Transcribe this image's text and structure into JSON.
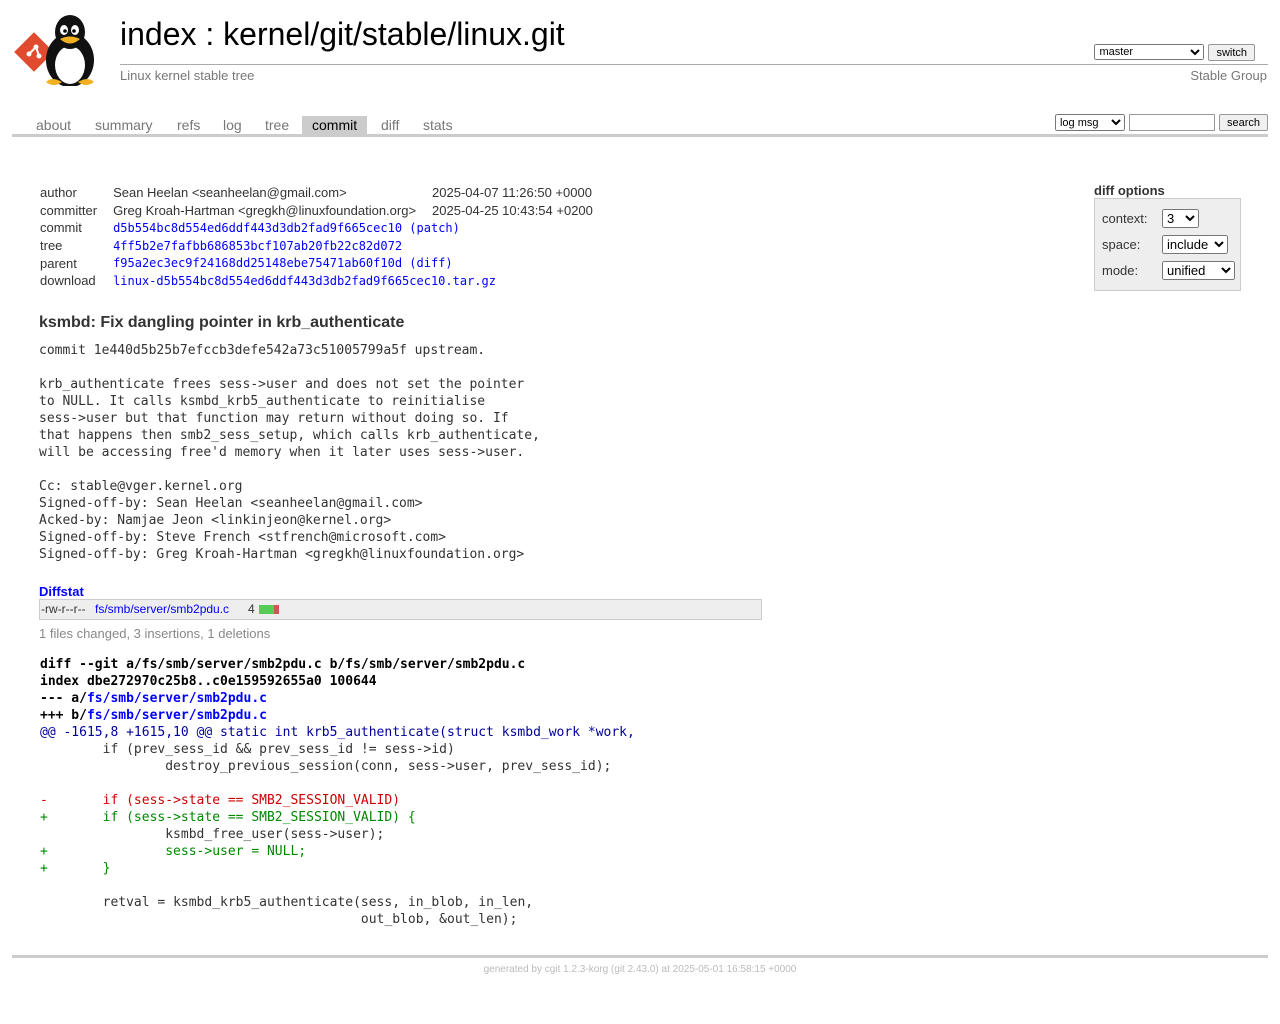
{
  "header": {
    "title_index": "index",
    "title_separator": " : ",
    "title_repo": "kernel/git/stable/linux.git",
    "description": "Linux kernel stable tree",
    "branch_selected": "master",
    "switch_label": "switch",
    "owner": "Stable Group"
  },
  "tabs": [
    "about",
    "summary",
    "refs",
    "log",
    "tree",
    "commit",
    "diff",
    "stats"
  ],
  "active_tab": "commit",
  "search": {
    "scope": "log msg",
    "button": "search"
  },
  "commit_info": {
    "author_label": "author",
    "author": "Sean Heelan <seanheelan@gmail.com>",
    "author_date": "2025-04-07 11:26:50 +0000",
    "committer_label": "committer",
    "committer": "Greg Kroah-Hartman <gregkh@linuxfoundation.org>",
    "committer_date": "2025-04-25 10:43:54 +0200",
    "commit_label": "commit",
    "commit": "d5b554bc8d554ed6ddf443d3db2fad9f665cec10",
    "patch_link": "patch",
    "tree_label": "tree",
    "tree": "4ff5b2e7fafbb686853bcf107ab20fb22c82d072",
    "parent_label": "parent",
    "parent": "f95a2ec3ec9f24168dd25148ebe75471ab60f10d",
    "diff_link": "diff",
    "download_label": "download",
    "download": "linux-d5b554bc8d554ed6ddf443d3db2fad9f665cec10.tar.gz"
  },
  "diff_options": {
    "title": "diff options",
    "context_label": "context:",
    "context_value": "3",
    "space_label": "space:",
    "space_value": "include",
    "mode_label": "mode:",
    "mode_value": "unified"
  },
  "subject": "ksmbd: Fix dangling pointer in krb_authenticate",
  "message": "commit 1e440d5b25b7efccb3defe542a73c51005799a5f upstream.\n\nkrb_authenticate frees sess->user and does not set the pointer\nto NULL. It calls ksmbd_krb5_authenticate to reinitialise\nsess->user but that function may return without doing so. If\nthat happens then smb2_sess_setup, which calls krb_authenticate,\nwill be accessing free'd memory when it later uses sess->user.\n\nCc: stable@vger.kernel.org\nSigned-off-by: Sean Heelan <seanheelan@gmail.com>\nAcked-by: Namjae Jeon <linkinjeon@kernel.org>\nSigned-off-by: Steve French <stfrench@microsoft.com>\nSigned-off-by: Greg Kroah-Hartman <gregkh@linuxfoundation.org>",
  "diffstat": {
    "header": "Diffstat",
    "mode": "-rw-r--r--",
    "path": "fs/smb/server/smb2pdu.c",
    "count": "4",
    "insertions": 3,
    "deletions": 1,
    "summary": "1 files changed, 3 insertions, 1 deletions"
  },
  "diff": {
    "line1": "diff --git a/fs/smb/server/smb2pdu.c b/fs/smb/server/smb2pdu.c",
    "line2": "index dbe272970c25b8..c0e159592655a0 100644",
    "minus_prefix": "--- a/",
    "plus_prefix": "+++ b/",
    "file": "fs/smb/server/smb2pdu.c",
    "hunk": "@@ -1615,8 +1615,10 @@ static int krb5_authenticate(struct ksmbd_work *work,",
    "lines": [
      {
        "type": "ctx",
        "text": " \tif (prev_sess_id && prev_sess_id != sess->id)"
      },
      {
        "type": "ctx",
        "text": " \t\tdestroy_previous_session(conn, sess->user, prev_sess_id);"
      },
      {
        "type": "ctx",
        "text": " "
      },
      {
        "type": "del",
        "text": "-\tif (sess->state == SMB2_SESSION_VALID)"
      },
      {
        "type": "add",
        "text": "+\tif (sess->state == SMB2_SESSION_VALID) {"
      },
      {
        "type": "ctx",
        "text": " \t\tksmbd_free_user(sess->user);"
      },
      {
        "type": "add",
        "text": "+\t\tsess->user = NULL;"
      },
      {
        "type": "add",
        "text": "+\t}"
      },
      {
        "type": "ctx",
        "text": " "
      },
      {
        "type": "ctx",
        "text": " \tretval = ksmbd_krb5_authenticate(sess, in_blob, in_len,"
      },
      {
        "type": "ctx",
        "text": " \t\t\t\t\t out_blob, &out_len);"
      }
    ]
  },
  "footer": {
    "prefix": "generated by ",
    "cgit": "cgit 1.2.3-korg",
    "git": " (git 2.43.0)",
    "suffix": " at 2025-05-01 16:58:15 +0000"
  }
}
